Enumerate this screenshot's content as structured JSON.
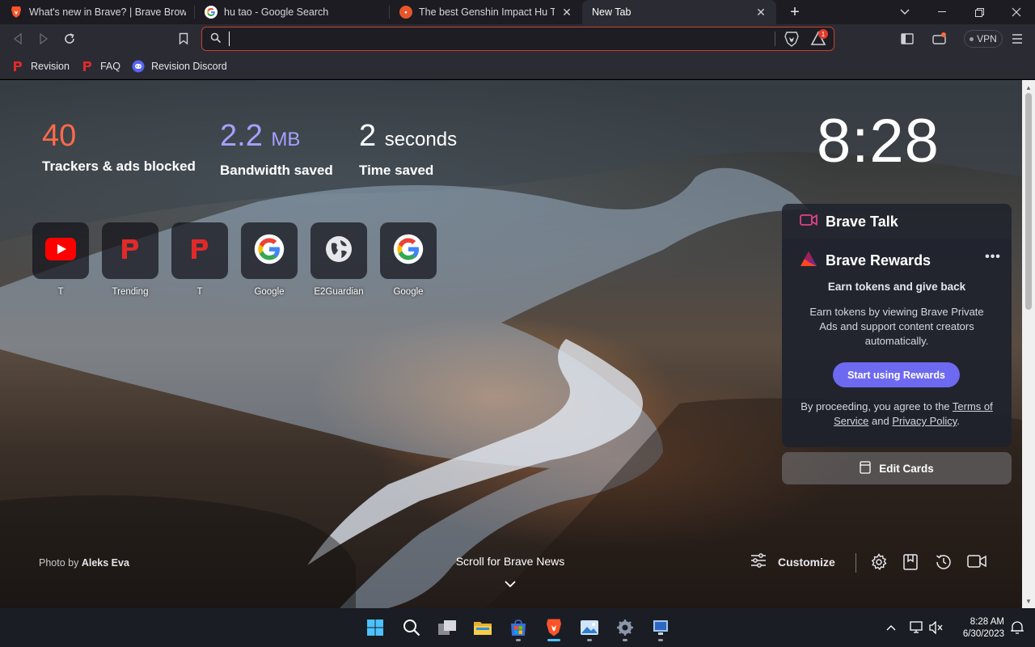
{
  "tabs": [
    {
      "title": "What's new in Brave? | Brave Browser",
      "favicon": "brave-lion-icon"
    },
    {
      "title": "hu tao - Google Search",
      "favicon": "google-icon"
    },
    {
      "title": "The best Genshin Impact Hu Tao build",
      "favicon": "site-icon"
    },
    {
      "title": "New Tab",
      "favicon": "none",
      "active": true
    }
  ],
  "toolbar": {
    "omnibox_value": "",
    "vpn_label": "VPN",
    "shield_badge": "1"
  },
  "bookmarks": [
    {
      "label": "Revision",
      "icon": "revision-icon"
    },
    {
      "label": "FAQ",
      "icon": "revision-icon"
    },
    {
      "label": "Revision Discord",
      "icon": "discord-icon"
    }
  ],
  "stats": {
    "trackers_value": "40",
    "trackers_label": "Trackers & ads blocked",
    "bandwidth_value": "2.2",
    "bandwidth_unit": "MB",
    "bandwidth_label": "Bandwidth saved",
    "time_value": "2",
    "time_unit": "seconds",
    "time_label": "Time saved"
  },
  "clock": "8:28",
  "top_sites": [
    {
      "name": "T",
      "icon": "youtube-icon"
    },
    {
      "name": "Trending",
      "icon": "revision-icon"
    },
    {
      "name": "T",
      "icon": "revision-icon"
    },
    {
      "name": "Google",
      "icon": "google-icon"
    },
    {
      "name": "E2Guardian",
      "icon": "globe-icon"
    },
    {
      "name": "Google",
      "icon": "google-icon"
    }
  ],
  "brave_talk": {
    "title": "Brave Talk"
  },
  "rewards": {
    "title": "Brave Rewards",
    "subtitle": "Earn tokens and give back",
    "description": "Earn tokens by viewing Brave Private Ads and support content creators automatically.",
    "button": "Start using Rewards",
    "legal_prefix": "By proceeding, you agree to the ",
    "terms": "Terms of Service",
    "and": " and ",
    "privacy": "Privacy Policy",
    "suffix": "."
  },
  "edit_cards": "Edit Cards",
  "footer": {
    "photo_prefix": "Photo by ",
    "photographer": "Aleks Eva",
    "scroll_news": "Scroll for Brave News",
    "customize": "Customize"
  },
  "taskbar": {
    "time": "8:28 AM",
    "date": "6/30/2023"
  },
  "colors": {
    "trackers": "#ff6a4a",
    "bandwidth": "#a6a1ff",
    "rewards_button": "#6d69f0",
    "omnibox_border": "#c4442a"
  }
}
